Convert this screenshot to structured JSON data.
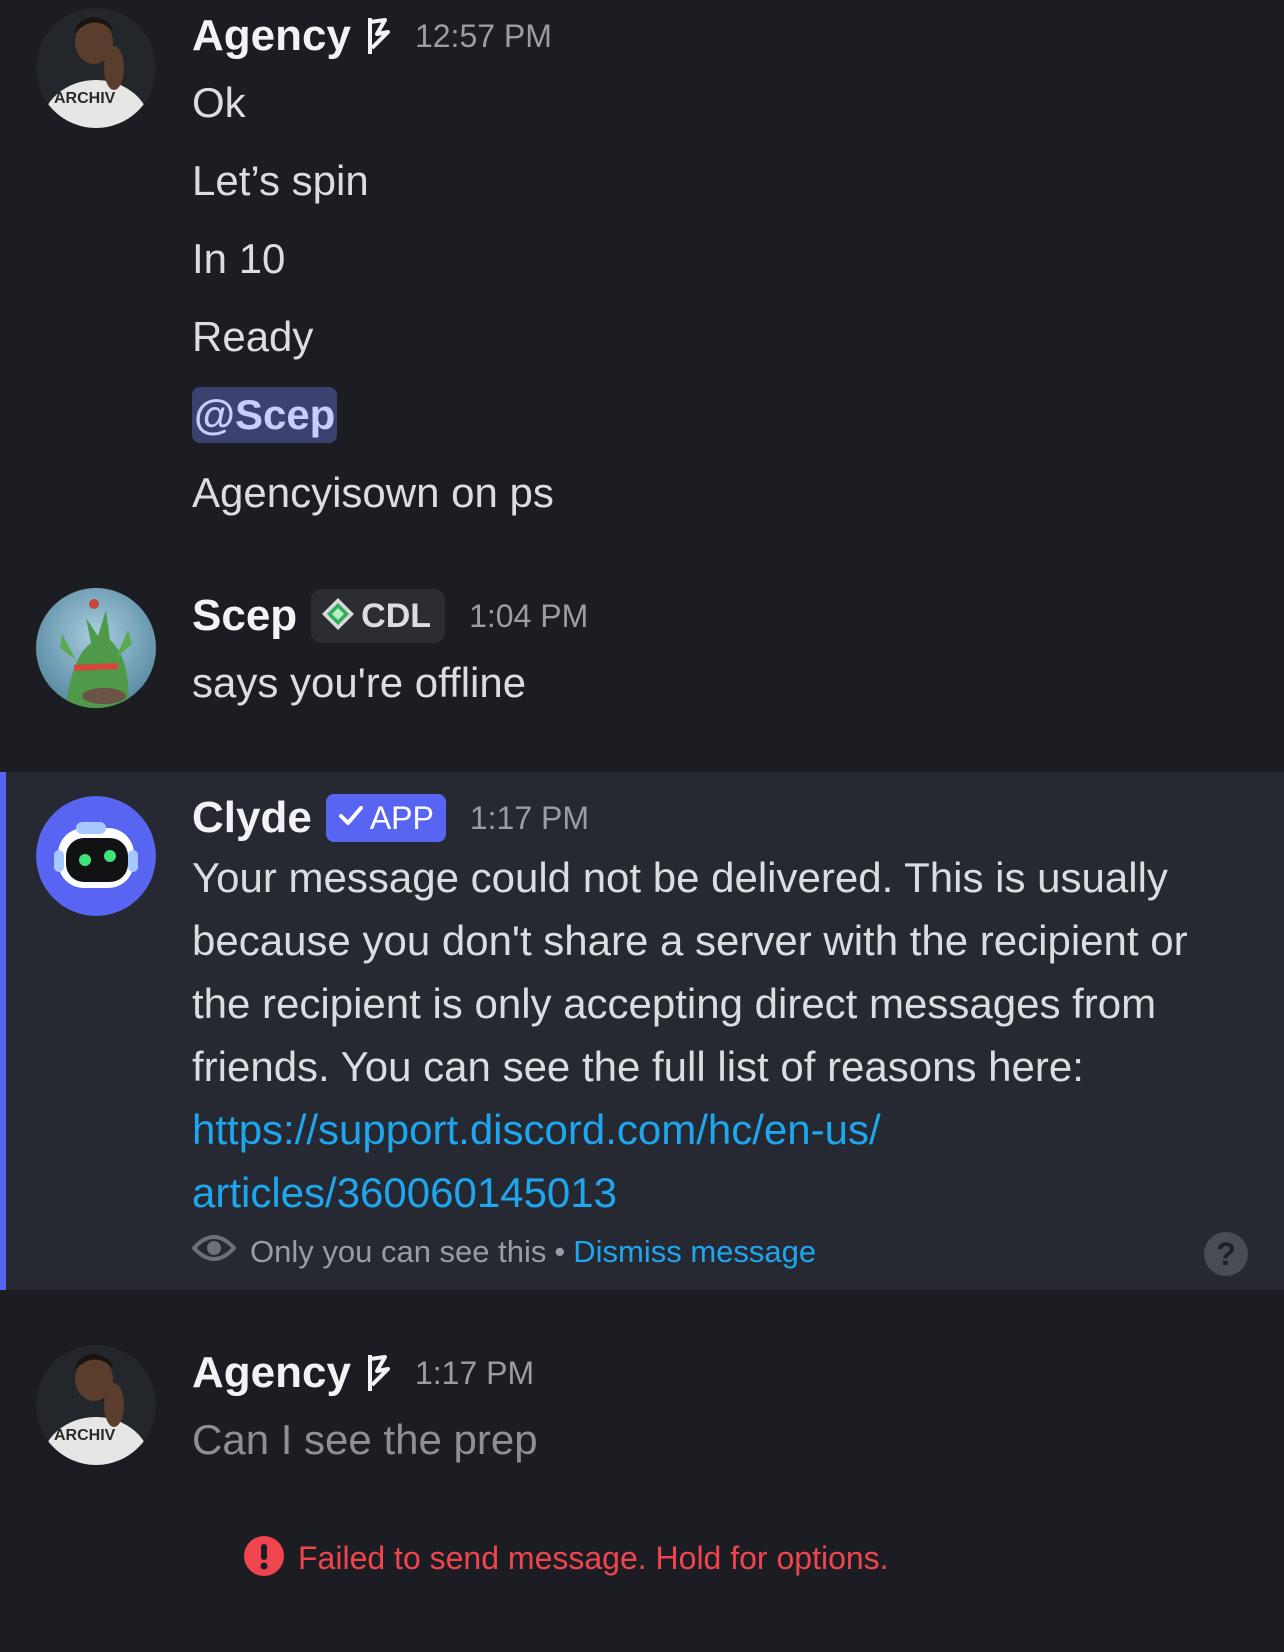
{
  "messages": {
    "m1": {
      "username": "Agency",
      "timestamp": "12:57 PM",
      "lines": [
        "Ok",
        "Let’s spin",
        "In 10",
        "Ready",
        "@Scep",
        "Agencyisown on ps"
      ]
    },
    "m2": {
      "username": "Scep",
      "role": "CDL",
      "timestamp": "1:04 PM",
      "lines": [
        "says you're offline"
      ]
    },
    "m3": {
      "username": "Clyde",
      "badge": "APP",
      "timestamp": "1:17 PM",
      "text_before_link": "Your message could not be delivered. This is usually because you don't share a server with the recipient or the recipient is only accepting direct messages from friends. You can see the full list of reasons here: ",
      "link_line1": "https://support.discord.com/hc/en-us/",
      "link_line2": "articles/360060145013",
      "ephemeral_note": "Only you can see this",
      "separator": "•",
      "dismiss_label": "Dismiss message",
      "help_glyph": "?"
    },
    "m4": {
      "username": "Agency",
      "timestamp": "1:17 PM",
      "lines": [
        "Can I see the prep"
      ]
    }
  },
  "failed_notice": {
    "icon": "!",
    "text": "Failed to send message. Hold for options."
  },
  "colors": {
    "background": "#1c1d22",
    "clyde_highlight": "#272932",
    "brand": "#5865f2",
    "link": "#1ea6ee",
    "error": "#f0454f",
    "mention_bg": "#3c4270"
  },
  "icons": [
    "flag-icon",
    "role-gem-icon",
    "verified-check-icon",
    "eye-icon",
    "help-icon",
    "error-icon"
  ]
}
